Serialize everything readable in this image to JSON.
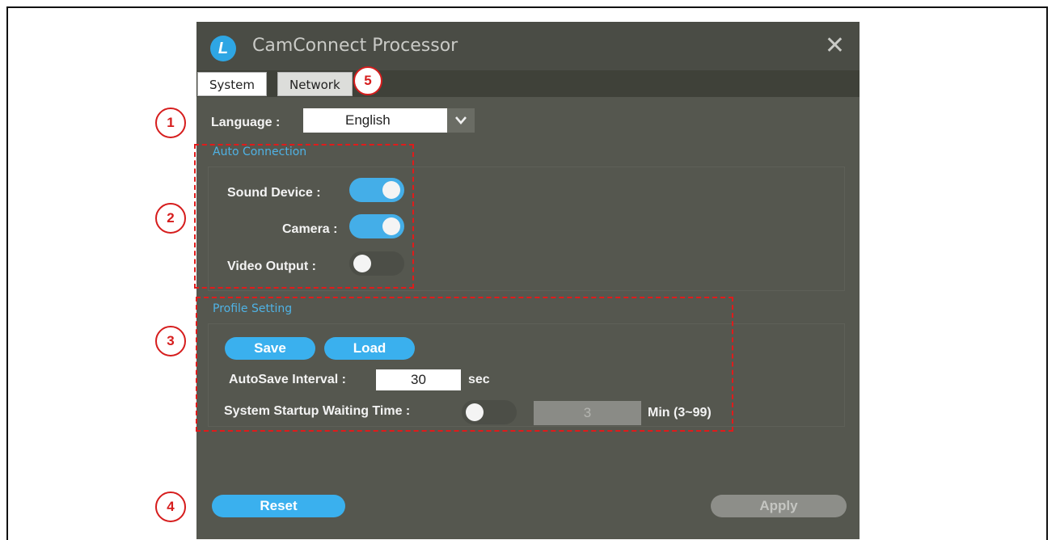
{
  "window": {
    "title": "CamConnect Processor",
    "logo_letter": "L"
  },
  "tabs": [
    {
      "label": "System"
    },
    {
      "label": "Network"
    }
  ],
  "language": {
    "label": "Language :",
    "value": "English"
  },
  "auto_connection": {
    "title": "Auto Connection",
    "items": [
      {
        "label": "Sound Device :",
        "enabled": true
      },
      {
        "label": "Camera :",
        "enabled": true
      },
      {
        "label": "Video Output :",
        "enabled": false
      }
    ]
  },
  "profile_setting": {
    "title": "Profile Setting",
    "save_label": "Save",
    "load_label": "Load",
    "autosave_label": "AutoSave Interval :",
    "autosave_value": "30",
    "autosave_unit": "sec",
    "startup_label": "System Startup Waiting Time :",
    "startup_enabled": false,
    "startup_value": "3",
    "startup_unit": "Min (3~99)"
  },
  "footer": {
    "reset_label": "Reset",
    "apply_label": "Apply"
  },
  "annotations": [
    "1",
    "2",
    "3",
    "4",
    "5"
  ],
  "colors": {
    "accent": "#3ab0ee",
    "annotation": "#e01b1b",
    "dialog_bg": "#55574f"
  }
}
